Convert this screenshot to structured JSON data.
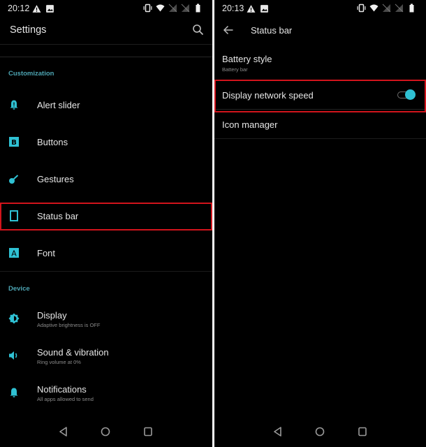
{
  "colors": {
    "accent": "#2fc1d3",
    "section_header": "#4da5b3",
    "highlight": "#d2141c",
    "background": "#000000"
  },
  "left": {
    "status_bar": {
      "time": "20:12",
      "left_icons": [
        "warning-icon",
        "image-icon"
      ],
      "right_icons": [
        "vibrate-icon",
        "wifi-icon",
        "no-sim-icon",
        "no-sim-icon",
        "battery-icon"
      ]
    },
    "app_bar": {
      "title": "Settings",
      "action_icon": "search-icon"
    },
    "sections": [
      {
        "header": "Customization",
        "items": [
          {
            "title": "Alert slider",
            "subtitle": "",
            "icon": "alert-slider-icon"
          },
          {
            "title": "Buttons",
            "subtitle": "",
            "icon": "buttons-icon"
          },
          {
            "title": "Gestures",
            "subtitle": "",
            "icon": "gestures-icon"
          },
          {
            "title": "Status bar",
            "subtitle": "",
            "icon": "status-bar-icon",
            "highlighted": true
          },
          {
            "title": "Font",
            "subtitle": "",
            "icon": "font-icon"
          }
        ]
      },
      {
        "header": "Device",
        "items": [
          {
            "title": "Display",
            "subtitle": "Adaptive brightness is OFF",
            "icon": "brightness-icon"
          },
          {
            "title": "Sound & vibration",
            "subtitle": "Ring volume at 0%",
            "icon": "volume-icon"
          },
          {
            "title": "Notifications",
            "subtitle": "All apps allowed to send",
            "icon": "bell-icon"
          }
        ]
      }
    ],
    "nav_bar": [
      "back-icon",
      "home-icon",
      "recents-icon"
    ]
  },
  "right": {
    "status_bar": {
      "time": "20:13",
      "left_icons": [
        "warning-icon",
        "image-icon"
      ],
      "right_icons": [
        "vibrate-icon",
        "wifi-icon",
        "no-sim-icon",
        "no-sim-icon",
        "battery-icon"
      ]
    },
    "app_bar": {
      "title": "Status bar",
      "nav_icon": "back-arrow-icon"
    },
    "preferences": [
      {
        "title": "Battery style",
        "subtitle": "Battery bar"
      },
      {
        "title": "Display network speed",
        "subtitle": "",
        "toggle": true,
        "toggle_on": true,
        "highlighted": true
      },
      {
        "title": "Icon manager",
        "subtitle": ""
      }
    ],
    "nav_bar": [
      "back-icon",
      "home-icon",
      "recents-icon"
    ]
  }
}
